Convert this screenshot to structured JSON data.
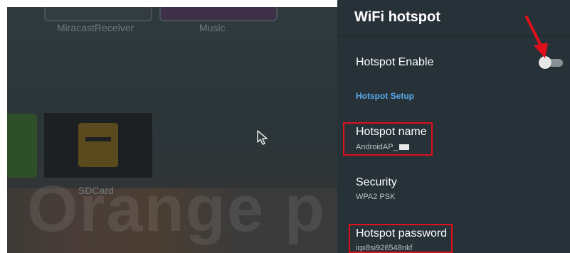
{
  "launcher": {
    "apps": [
      {
        "label": "MiracastReceiver"
      },
      {
        "label": "Music"
      },
      {
        "label": "SDCard"
      }
    ],
    "watermark": "Orange p"
  },
  "panel": {
    "title": "WiFi hotspot",
    "enable": {
      "label": "Hotspot Enable",
      "enabled": false
    },
    "section_header": "Hotspot Setup",
    "hotspot_name": {
      "title": "Hotspot name",
      "value": "AndroidAP_"
    },
    "security": {
      "title": "Security",
      "value": "WPA2 PSK"
    },
    "hotspot_password": {
      "title": "Hotspot password",
      "value": "iqx8si926548nkf"
    }
  },
  "colors": {
    "panel_bg": "#263238",
    "accent": "#5aa8ea",
    "annotation": "#e0101a"
  },
  "icons": [
    "cursor-arrow-icon",
    "sd-card-icon",
    "annotation-arrow-icon"
  ]
}
